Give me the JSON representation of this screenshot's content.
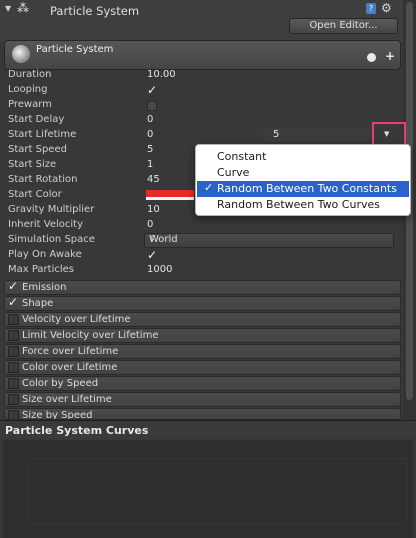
{
  "header": {
    "title": "Particle System",
    "open_editor": "Open Editor...",
    "module_title": "Particle System"
  },
  "properties": [
    {
      "label": "Duration",
      "value": "10.00"
    },
    {
      "label": "Looping",
      "checked": true
    },
    {
      "label": "Prewarm",
      "checked": false
    },
    {
      "label": "Start Delay",
      "value": "0"
    },
    {
      "label": "Start Lifetime",
      "value": "0",
      "value2": "5"
    },
    {
      "label": "Start Speed",
      "value": "5"
    },
    {
      "label": "Start Size",
      "value": "1"
    },
    {
      "label": "Start Rotation",
      "value": "45"
    },
    {
      "label": "Start Color",
      "color": "#e52b2b"
    },
    {
      "label": "Gravity Multiplier",
      "value": "10"
    },
    {
      "label": "Inherit Velocity",
      "value": "0"
    },
    {
      "label": "Simulation Space",
      "value": "World"
    },
    {
      "label": "Play On Awake",
      "checked": true
    },
    {
      "label": "Max Particles",
      "value": "1000"
    }
  ],
  "modules": [
    {
      "label": "Emission",
      "enabled": true
    },
    {
      "label": "Shape",
      "enabled": true
    },
    {
      "label": "Velocity over Lifetime",
      "enabled": false
    },
    {
      "label": "Limit Velocity over Lifetime",
      "enabled": false
    },
    {
      "label": "Force over Lifetime",
      "enabled": false
    },
    {
      "label": "Color over Lifetime",
      "enabled": false
    },
    {
      "label": "Color by Speed",
      "enabled": false
    },
    {
      "label": "Size over Lifetime",
      "enabled": false
    },
    {
      "label": "Size by Speed",
      "enabled": false
    }
  ],
  "popup": {
    "options": [
      "Constant",
      "Curve",
      "Random Between Two Constants",
      "Random Between Two Curves"
    ],
    "selected": "Random Between Two Constants"
  },
  "curves": {
    "title": "Particle System Curves"
  }
}
